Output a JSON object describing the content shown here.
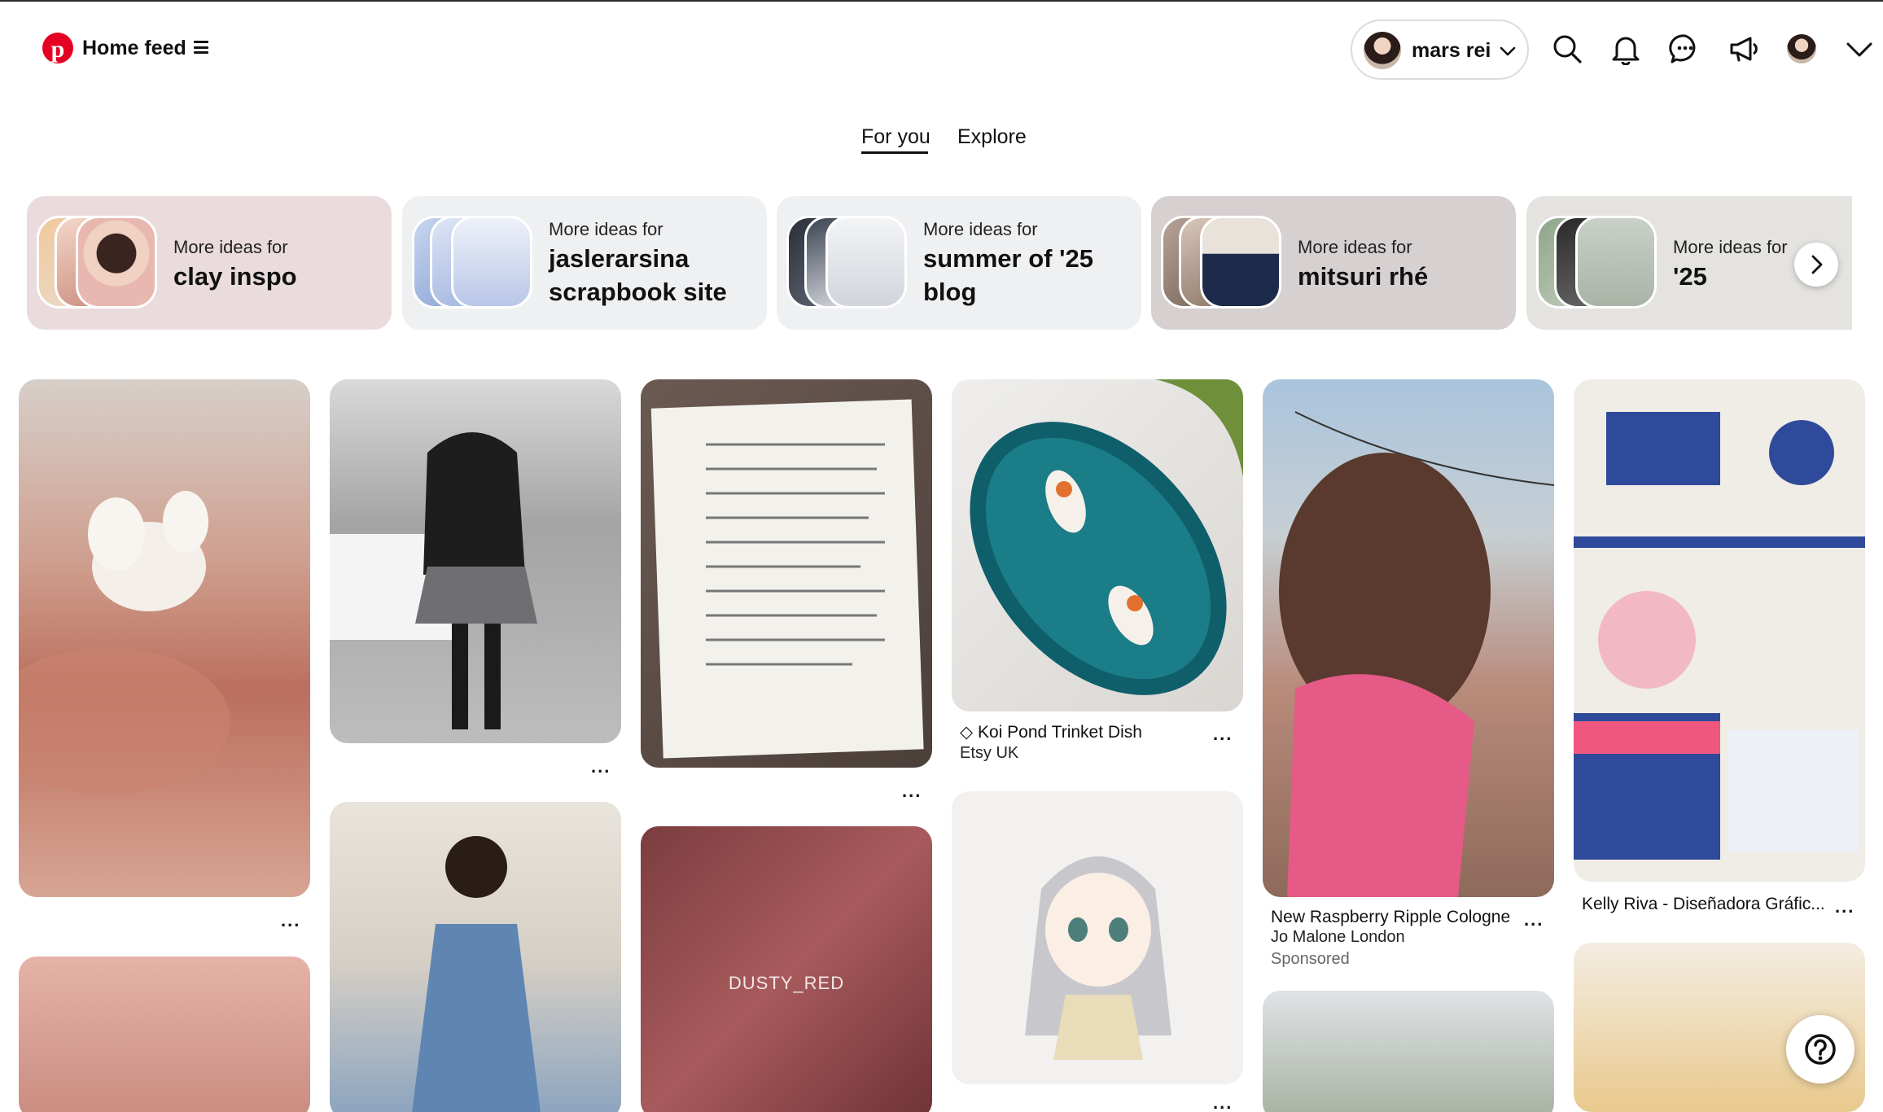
{
  "header": {
    "title": "Home feed",
    "account_name": "mars rei",
    "icons": [
      "pinterest-logo",
      "menu-icon",
      "chevron-down-icon",
      "search-icon",
      "bell-icon",
      "messages-icon",
      "megaphone-icon",
      "avatar",
      "chevron-down-icon"
    ]
  },
  "tabs": [
    {
      "label": "For you",
      "active": true
    },
    {
      "label": "Explore",
      "active": false
    }
  ],
  "idea_cards": [
    {
      "kicker": "More ideas for",
      "title": "clay inspo"
    },
    {
      "kicker": "More ideas for",
      "title": "jaslerarsina scrapbook site"
    },
    {
      "kicker": "More ideas for",
      "title": "summer of '25 blog"
    },
    {
      "kicker": "More ideas for",
      "title": "mitsuri rhé"
    },
    {
      "kicker": "More ideas for",
      "title": "'25"
    }
  ],
  "pins": {
    "koi": {
      "title": "Koi Pond Trinket Dish",
      "source": "Etsy UK"
    },
    "cologne": {
      "title": "New Raspberry Ripple Cologne",
      "source": "Jo Malone London",
      "sponsored": "Sponsored"
    },
    "portfolio": {
      "title": "Kelly Riva - Diseñadora Gráfic..."
    },
    "hair_overlay": "DUSTY_RED",
    "more_label": "..."
  },
  "colors": {
    "brand": "#e60023",
    "idea_card_bg": [
      "#eadcdc",
      "#eff0f2",
      "#eff0f2",
      "#d6d0d1",
      "#e5e3e0"
    ]
  }
}
